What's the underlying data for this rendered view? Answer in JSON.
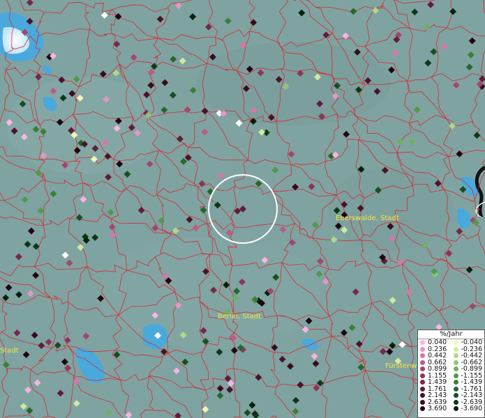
{
  "map": {
    "city_labels": {
      "eberswalde": "Eberswalde, Stadt",
      "berlin": "Berlin, Stadt",
      "furstenwalde": "Fürstenw",
      "stadt_left": "Stadt"
    },
    "colors": {
      "background": "#7fa3a1",
      "boundaries": "#d8262e",
      "water": "#4faee0",
      "label": "#f2e640"
    }
  },
  "legend": {
    "title": "%/Jahr",
    "positive": [
      {
        "label": "0.040",
        "color": "#f7b4e0"
      },
      {
        "label": "0.236",
        "color": "#e496c4"
      },
      {
        "label": "0.442",
        "color": "#d27aa6"
      },
      {
        "label": "0.662",
        "color": "#bb5c88"
      },
      {
        "label": "0.899",
        "color": "#a3476e"
      },
      {
        "label": "1.155",
        "color": "#8c3558"
      },
      {
        "label": "1.439",
        "color": "#762847"
      },
      {
        "label": "1.761",
        "color": "#611c37"
      },
      {
        "label": "2.143",
        "color": "#4c1329"
      },
      {
        "label": "2.639",
        "color": "#370c1c"
      },
      {
        "label": "3.690",
        "color": "#200510"
      }
    ],
    "negative": [
      {
        "label": "-0.040",
        "color": "#eef8b6"
      },
      {
        "label": "-0.236",
        "color": "#cfeaa0"
      },
      {
        "label": "-0.442",
        "color": "#aed88a"
      },
      {
        "label": "-0.662",
        "color": "#8fc677"
      },
      {
        "label": "-0.899",
        "color": "#6fb160"
      },
      {
        "label": "-1.155",
        "color": "#53994c"
      },
      {
        "label": "-1.439",
        "color": "#3b7f3a"
      },
      {
        "label": "-1.761",
        "color": "#28662c"
      },
      {
        "label": "-2.143",
        "color": "#184e20"
      },
      {
        "label": "-2.639",
        "color": "#0d3815"
      },
      {
        "label": "-3.690",
        "color": "#04210b"
      }
    ]
  }
}
